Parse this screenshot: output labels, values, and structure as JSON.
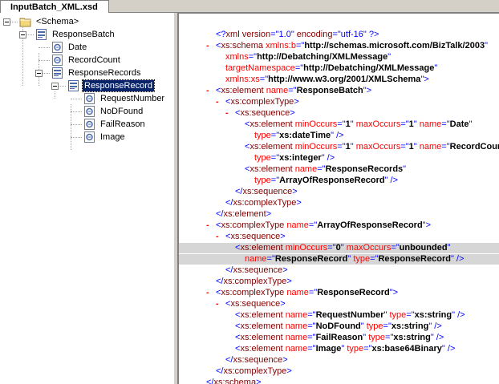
{
  "tab": {
    "title": "InputBatch_XML.xsd"
  },
  "tree": {
    "items": [
      {
        "label": "<Schema>",
        "kind": "folder"
      },
      {
        "label": "ResponseBatch",
        "kind": "record"
      },
      {
        "label": "Date",
        "kind": "field"
      },
      {
        "label": "RecordCount",
        "kind": "field"
      },
      {
        "label": "ResponseRecords",
        "kind": "record"
      },
      {
        "label": "ResponseRecord",
        "kind": "record",
        "selected": true
      },
      {
        "label": "RequestNumber",
        "kind": "field"
      },
      {
        "label": "NoDFound",
        "kind": "field"
      },
      {
        "label": "FailReason",
        "kind": "field"
      },
      {
        "label": "Image",
        "kind": "field"
      }
    ]
  },
  "xml": {
    "lines": [
      {
        "minus": false,
        "indent": 0,
        "parts": [
          [
            "b",
            "<?"
          ],
          [
            "br",
            "xml version"
          ],
          [
            "b",
            "=\""
          ],
          [
            "b",
            "1.0"
          ],
          [
            "b",
            "\" "
          ],
          [
            "br",
            "encoding"
          ],
          [
            "b",
            "=\""
          ],
          [
            "b",
            "utf-16"
          ],
          [
            "b",
            "\" ?>"
          ]
        ]
      },
      {
        "minus": true,
        "indent": 0,
        "parts": [
          [
            "b",
            "<"
          ],
          [
            "br",
            "xs:schema"
          ],
          [
            "r",
            " xmlns:b"
          ],
          [
            "b",
            "=\""
          ],
          [
            "v",
            "http://schemas.microsoft.com/BizTalk/2003"
          ],
          [
            "b",
            "\""
          ]
        ]
      },
      {
        "minus": false,
        "indent": 1,
        "parts": [
          [
            "r",
            "xmlns"
          ],
          [
            "b",
            "=\""
          ],
          [
            "v",
            "http://Debatching/XMLMessage"
          ],
          [
            "b",
            "\""
          ]
        ]
      },
      {
        "minus": false,
        "indent": 1,
        "parts": [
          [
            "r",
            "targetNamespace"
          ],
          [
            "b",
            "=\""
          ],
          [
            "v",
            "http://Debatching/XMLMessage"
          ],
          [
            "b",
            "\""
          ]
        ]
      },
      {
        "minus": false,
        "indent": 1,
        "parts": [
          [
            "r",
            "xmlns:xs"
          ],
          [
            "b",
            "=\""
          ],
          [
            "v",
            "http://www.w3.org/2001/XMLSchema"
          ],
          [
            "b",
            "\">"
          ]
        ]
      },
      {
        "minus": true,
        "indent": 0,
        "parts": [
          [
            "b",
            "<"
          ],
          [
            "br",
            "xs:element"
          ],
          [
            "r",
            " name"
          ],
          [
            "b",
            "=\""
          ],
          [
            "v",
            "ResponseBatch"
          ],
          [
            "b",
            "\">"
          ]
        ]
      },
      {
        "minus": true,
        "indent": 1,
        "parts": [
          [
            "b",
            "<"
          ],
          [
            "br",
            "xs:complexType"
          ],
          [
            "b",
            ">"
          ]
        ]
      },
      {
        "minus": true,
        "indent": 2,
        "parts": [
          [
            "b",
            "<"
          ],
          [
            "br",
            "xs:sequence"
          ],
          [
            "b",
            ">"
          ]
        ]
      },
      {
        "minus": false,
        "indent": 3,
        "parts": [
          [
            "b",
            "<"
          ],
          [
            "br",
            "xs:element"
          ],
          [
            "r",
            " minOccurs"
          ],
          [
            "b",
            "=\""
          ],
          [
            "v",
            "1"
          ],
          [
            "b",
            "\" "
          ],
          [
            "r",
            "maxOccurs"
          ],
          [
            "b",
            "=\""
          ],
          [
            "v",
            "1"
          ],
          [
            "b",
            "\" "
          ],
          [
            "r",
            "name"
          ],
          [
            "b",
            "=\""
          ],
          [
            "v",
            "Date"
          ],
          [
            "b",
            "\""
          ]
        ]
      },
      {
        "minus": false,
        "indent": 4,
        "parts": [
          [
            "r",
            "type"
          ],
          [
            "b",
            "=\""
          ],
          [
            "v",
            "xs:dateTime"
          ],
          [
            "b",
            "\" />"
          ]
        ]
      },
      {
        "minus": false,
        "indent": 3,
        "parts": [
          [
            "b",
            "<"
          ],
          [
            "br",
            "xs:element"
          ],
          [
            "r",
            " minOccurs"
          ],
          [
            "b",
            "=\""
          ],
          [
            "v",
            "1"
          ],
          [
            "b",
            "\" "
          ],
          [
            "r",
            "maxOccurs"
          ],
          [
            "b",
            "=\""
          ],
          [
            "v",
            "1"
          ],
          [
            "b",
            "\" "
          ],
          [
            "r",
            "name"
          ],
          [
            "b",
            "=\""
          ],
          [
            "v",
            "RecordCount"
          ],
          [
            "b",
            "\""
          ]
        ]
      },
      {
        "minus": false,
        "indent": 4,
        "parts": [
          [
            "r",
            "type"
          ],
          [
            "b",
            "=\""
          ],
          [
            "v",
            "xs:integer"
          ],
          [
            "b",
            "\" />"
          ]
        ]
      },
      {
        "minus": false,
        "indent": 3,
        "parts": [
          [
            "b",
            "<"
          ],
          [
            "br",
            "xs:element"
          ],
          [
            "r",
            " name"
          ],
          [
            "b",
            "=\""
          ],
          [
            "v",
            "ResponseRecords"
          ],
          [
            "b",
            "\""
          ]
        ]
      },
      {
        "minus": false,
        "indent": 4,
        "parts": [
          [
            "r",
            "type"
          ],
          [
            "b",
            "=\""
          ],
          [
            "v",
            "ArrayOfResponseRecord"
          ],
          [
            "b",
            "\" />"
          ]
        ]
      },
      {
        "minus": false,
        "indent": 2,
        "parts": [
          [
            "b",
            "</"
          ],
          [
            "br",
            "xs:sequence"
          ],
          [
            "b",
            ">"
          ]
        ]
      },
      {
        "minus": false,
        "indent": 1,
        "parts": [
          [
            "b",
            "</"
          ],
          [
            "br",
            "xs:complexType"
          ],
          [
            "b",
            ">"
          ]
        ]
      },
      {
        "minus": false,
        "indent": 0,
        "parts": [
          [
            "b",
            "</"
          ],
          [
            "br",
            "xs:element"
          ],
          [
            "b",
            ">"
          ]
        ]
      },
      {
        "minus": true,
        "indent": 0,
        "parts": [
          [
            "b",
            "<"
          ],
          [
            "br",
            "xs:complexType"
          ],
          [
            "r",
            " name"
          ],
          [
            "b",
            "=\""
          ],
          [
            "v",
            "ArrayOfResponseRecord"
          ],
          [
            "b",
            "\">"
          ]
        ]
      },
      {
        "minus": true,
        "indent": 1,
        "parts": [
          [
            "b",
            "<"
          ],
          [
            "br",
            "xs:sequence"
          ],
          [
            "b",
            ">"
          ]
        ]
      },
      {
        "minus": false,
        "indent": 2,
        "hl": true,
        "parts": [
          [
            "b",
            "<"
          ],
          [
            "br",
            "xs:element"
          ],
          [
            "r",
            " minOccurs"
          ],
          [
            "b",
            "=\""
          ],
          [
            "v",
            "0"
          ],
          [
            "b",
            "\" "
          ],
          [
            "r",
            "maxOccurs"
          ],
          [
            "b",
            "=\""
          ],
          [
            "v",
            "unbounded"
          ],
          [
            "b",
            "\""
          ]
        ]
      },
      {
        "minus": false,
        "indent": 3,
        "hl": true,
        "parts": [
          [
            "r",
            "name"
          ],
          [
            "b",
            "=\""
          ],
          [
            "v",
            "ResponseRecord"
          ],
          [
            "b",
            "\" "
          ],
          [
            "r",
            "type"
          ],
          [
            "b",
            "=\""
          ],
          [
            "v",
            "ResponseRecord"
          ],
          [
            "b",
            "\" />"
          ]
        ]
      },
      {
        "minus": false,
        "indent": 1,
        "parts": [
          [
            "b",
            "</"
          ],
          [
            "br",
            "xs:sequence"
          ],
          [
            "b",
            ">"
          ]
        ]
      },
      {
        "minus": false,
        "indent": 0,
        "parts": [
          [
            "b",
            "</"
          ],
          [
            "br",
            "xs:complexType"
          ],
          [
            "b",
            ">"
          ]
        ]
      },
      {
        "minus": true,
        "indent": 0,
        "parts": [
          [
            "b",
            "<"
          ],
          [
            "br",
            "xs:complexType"
          ],
          [
            "r",
            " name"
          ],
          [
            "b",
            "=\""
          ],
          [
            "v",
            "ResponseRecord"
          ],
          [
            "b",
            "\">"
          ]
        ]
      },
      {
        "minus": true,
        "indent": 1,
        "parts": [
          [
            "b",
            "<"
          ],
          [
            "br",
            "xs:sequence"
          ],
          [
            "b",
            ">"
          ]
        ]
      },
      {
        "minus": false,
        "indent": 2,
        "parts": [
          [
            "b",
            "<"
          ],
          [
            "br",
            "xs:element"
          ],
          [
            "r",
            " name"
          ],
          [
            "b",
            "=\""
          ],
          [
            "v",
            "RequestNumber"
          ],
          [
            "b",
            "\" "
          ],
          [
            "r",
            "type"
          ],
          [
            "b",
            "=\""
          ],
          [
            "v",
            "xs:string"
          ],
          [
            "b",
            "\" />"
          ]
        ]
      },
      {
        "minus": false,
        "indent": 2,
        "parts": [
          [
            "b",
            "<"
          ],
          [
            "br",
            "xs:element"
          ],
          [
            "r",
            " name"
          ],
          [
            "b",
            "=\""
          ],
          [
            "v",
            "NoDFound"
          ],
          [
            "b",
            "\" "
          ],
          [
            "r",
            "type"
          ],
          [
            "b",
            "=\""
          ],
          [
            "v",
            "xs:string"
          ],
          [
            "b",
            "\" />"
          ]
        ]
      },
      {
        "minus": false,
        "indent": 2,
        "parts": [
          [
            "b",
            "<"
          ],
          [
            "br",
            "xs:element"
          ],
          [
            "r",
            " name"
          ],
          [
            "b",
            "=\""
          ],
          [
            "v",
            "FailReason"
          ],
          [
            "b",
            "\" "
          ],
          [
            "r",
            "type"
          ],
          [
            "b",
            "=\""
          ],
          [
            "v",
            "xs:string"
          ],
          [
            "b",
            "\" />"
          ]
        ]
      },
      {
        "minus": false,
        "indent": 2,
        "parts": [
          [
            "b",
            "<"
          ],
          [
            "br",
            "xs:element"
          ],
          [
            "r",
            " name"
          ],
          [
            "b",
            "=\""
          ],
          [
            "v",
            "Image"
          ],
          [
            "b",
            "\" "
          ],
          [
            "r",
            "type"
          ],
          [
            "b",
            "=\""
          ],
          [
            "v",
            "xs:base64Binary"
          ],
          [
            "b",
            "\" />"
          ]
        ]
      },
      {
        "minus": false,
        "indent": 1,
        "parts": [
          [
            "b",
            "</"
          ],
          [
            "br",
            "xs:sequence"
          ],
          [
            "b",
            ">"
          ]
        ]
      },
      {
        "minus": false,
        "indent": 0,
        "parts": [
          [
            "b",
            "</"
          ],
          [
            "br",
            "xs:complexType"
          ],
          [
            "b",
            ">"
          ]
        ]
      },
      {
        "minus": false,
        "indent": -1,
        "parts": [
          [
            "b",
            "</"
          ],
          [
            "br",
            "xs:schema"
          ],
          [
            "b",
            ">"
          ]
        ]
      }
    ]
  },
  "colors": {
    "selection": "#0a246a",
    "markup": "#0000ff",
    "element": "#800000",
    "attribute": "#ff0000",
    "highlight": "#d6d6d6"
  }
}
